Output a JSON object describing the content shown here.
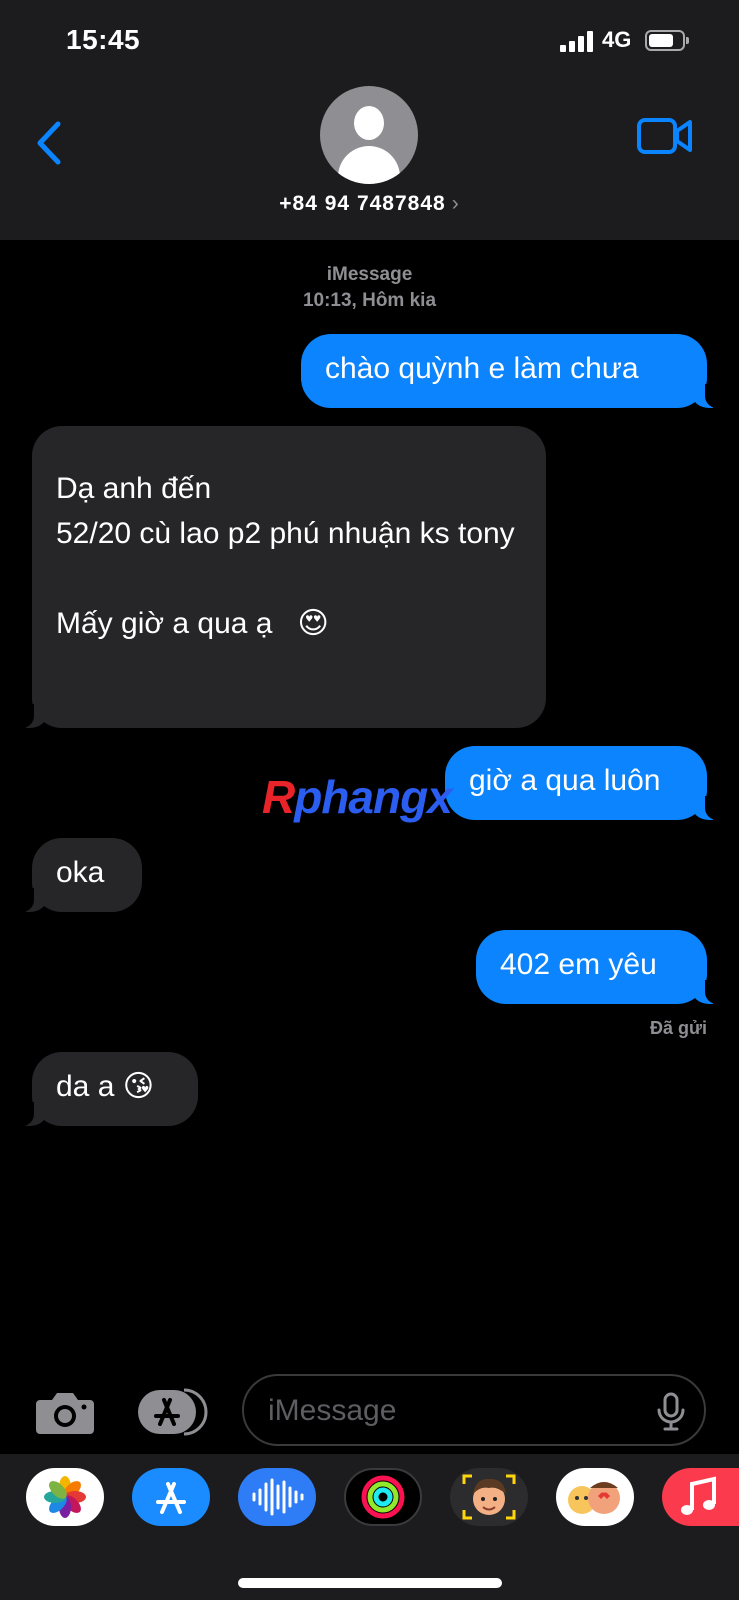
{
  "status_bar": {
    "time": "15:45",
    "network": "4G"
  },
  "header": {
    "contact": "+84 94 7487848",
    "chevron": "›",
    "icons": {
      "back": "chevron-left-icon",
      "video": "video-camera-icon",
      "avatar": "person-icon"
    }
  },
  "thread": {
    "service": "iMessage",
    "timestamp": "10:13, Hôm kia",
    "delivered": "Đã gửi",
    "messages": [
      {
        "from": "me",
        "text": "chào quỳnh e làm chưa"
      },
      {
        "from": "them",
        "text": "Dạ anh đến\n52/20 cù lao p2 phú nhuận ks tony\n\nMấy giờ a qua ạ   😍"
      },
      {
        "from": "me",
        "text": "giờ a qua luôn"
      },
      {
        "from": "them",
        "text": "oka"
      },
      {
        "from": "me",
        "text": "402 em yêu"
      },
      {
        "from": "them",
        "text": "da a 😘"
      }
    ]
  },
  "watermark": {
    "first": "R",
    "rest": "phangx"
  },
  "composer": {
    "placeholder": "iMessage"
  },
  "app_drawer": {
    "apps": [
      "photos-icon",
      "app-store-icon",
      "audio-message-icon",
      "activity-icon",
      "memoji-icon",
      "animoji-stickers-icon",
      "music-icon"
    ]
  },
  "colors": {
    "sent_bubble": "#0b84fe",
    "received_bubble": "#262628",
    "accent": "#0a84ff",
    "background": "#000000"
  }
}
